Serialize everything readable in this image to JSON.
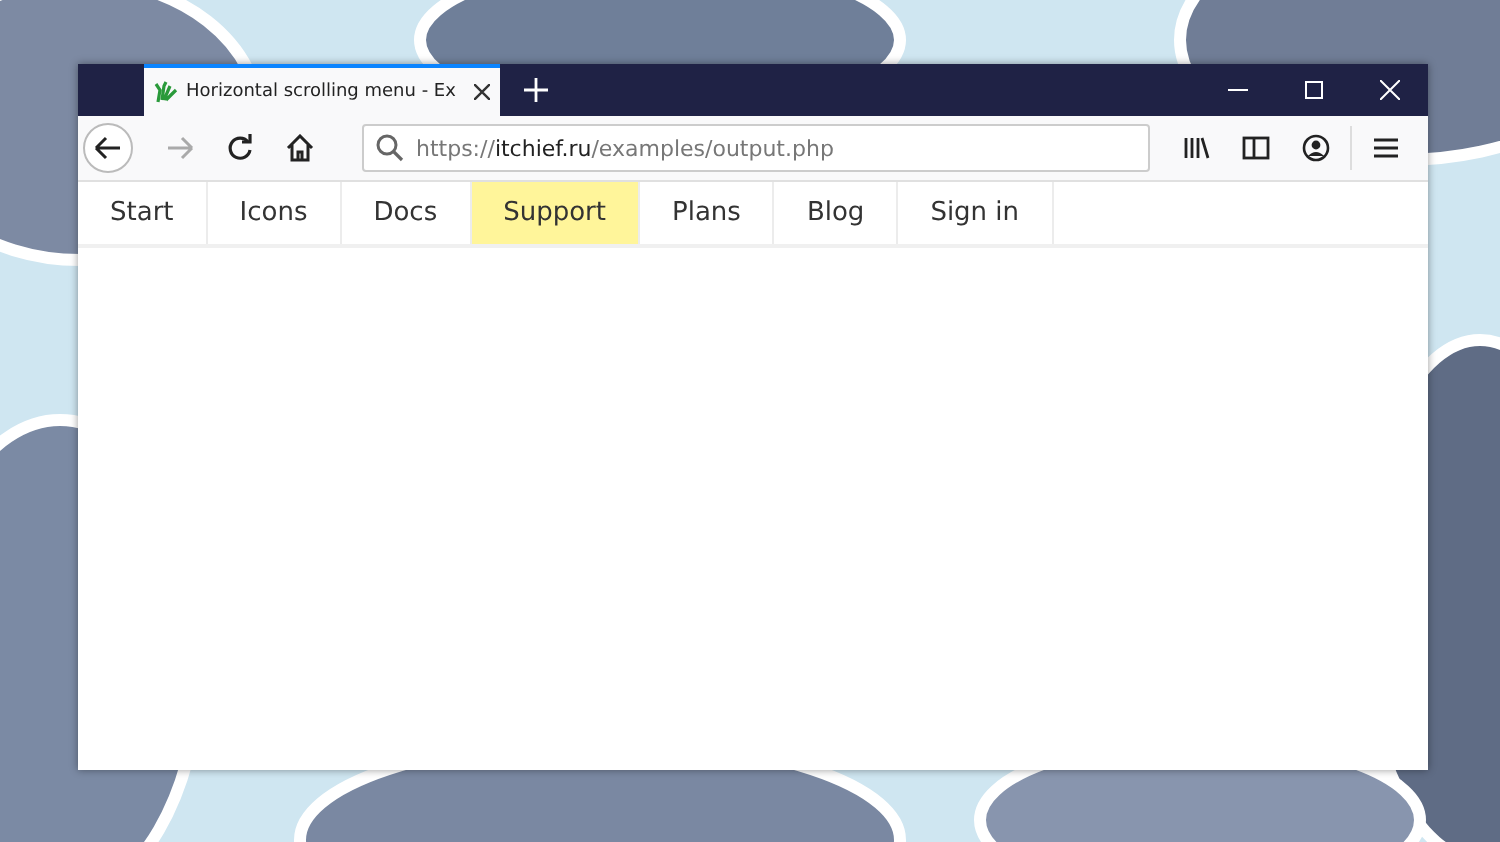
{
  "window": {
    "tab_title": "Horizontal scrolling menu - Ex",
    "address": {
      "scheme": "https://",
      "host": "itchief.ru",
      "path": "/examples/output.php"
    }
  },
  "menu": [
    {
      "label": "Start",
      "selected": false
    },
    {
      "label": "Icons",
      "selected": false
    },
    {
      "label": "Docs",
      "selected": false
    },
    {
      "label": "Support",
      "selected": true
    },
    {
      "label": "Plans",
      "selected": false
    },
    {
      "label": "Blog",
      "selected": false
    },
    {
      "label": "Sign in",
      "selected": false
    }
  ]
}
